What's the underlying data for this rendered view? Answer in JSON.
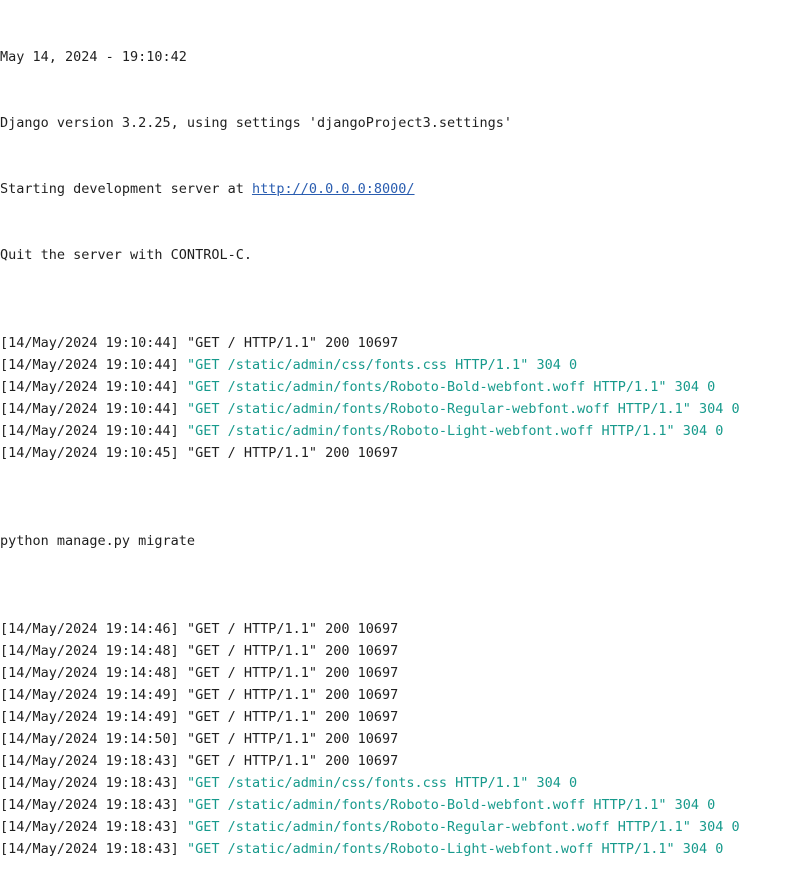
{
  "console": {
    "header": {
      "date_line": "May 14, 2024 - 19:10:42",
      "version_line": "Django version 3.2.25, using settings 'djangoProject3.settings'",
      "server_prefix": "Starting development server at ",
      "server_url": "http://0.0.0.0:8000/",
      "quit_line": "Quit the server with CONTROL-C."
    },
    "log_block_1": [
      {
        "ts": "[14/May/2024 19:10:44]",
        "req": "\"GET / HTTP/1.1\" 200 10697",
        "style": "plain"
      },
      {
        "ts": "[14/May/2024 19:10:44]",
        "req": "\"GET /static/admin/css/fonts.css HTTP/1.1\" 304 0",
        "style": "teal"
      },
      {
        "ts": "[14/May/2024 19:10:44]",
        "req": "\"GET /static/admin/fonts/Roboto-Bold-webfont.woff HTTP/1.1\" 304 0",
        "style": "teal"
      },
      {
        "ts": "[14/May/2024 19:10:44]",
        "req": "\"GET /static/admin/fonts/Roboto-Regular-webfont.woff HTTP/1.1\" 304 0",
        "style": "teal"
      },
      {
        "ts": "[14/May/2024 19:10:44]",
        "req": "\"GET /static/admin/fonts/Roboto-Light-webfont.woff HTTP/1.1\" 304 0",
        "style": "teal"
      },
      {
        "ts": "[14/May/2024 19:10:45]",
        "req": "\"GET / HTTP/1.1\" 200 10697",
        "style": "plain"
      }
    ],
    "command_line": "python manage.py migrate",
    "log_block_2": [
      {
        "ts": "[14/May/2024 19:14:46]",
        "req": "\"GET / HTTP/1.1\" 200 10697",
        "style": "plain"
      },
      {
        "ts": "[14/May/2024 19:14:48]",
        "req": "\"GET / HTTP/1.1\" 200 10697",
        "style": "plain"
      },
      {
        "ts": "[14/May/2024 19:14:48]",
        "req": "\"GET / HTTP/1.1\" 200 10697",
        "style": "plain"
      },
      {
        "ts": "[14/May/2024 19:14:49]",
        "req": "\"GET / HTTP/1.1\" 200 10697",
        "style": "plain"
      },
      {
        "ts": "[14/May/2024 19:14:49]",
        "req": "\"GET / HTTP/1.1\" 200 10697",
        "style": "plain"
      },
      {
        "ts": "[14/May/2024 19:14:50]",
        "req": "\"GET / HTTP/1.1\" 200 10697",
        "style": "plain"
      },
      {
        "ts": "[14/May/2024 19:18:43]",
        "req": "\"GET / HTTP/1.1\" 200 10697",
        "style": "plain"
      },
      {
        "ts": "[14/May/2024 19:18:43]",
        "req": "\"GET /static/admin/css/fonts.css HTTP/1.1\" 304 0",
        "style": "teal"
      },
      {
        "ts": "[14/May/2024 19:18:43]",
        "req": "\"GET /static/admin/fonts/Roboto-Bold-webfont.woff HTTP/1.1\" 304 0",
        "style": "teal"
      },
      {
        "ts": "[14/May/2024 19:18:43]",
        "req": "\"GET /static/admin/fonts/Roboto-Regular-webfont.woff HTTP/1.1\" 304 0",
        "style": "teal"
      },
      {
        "ts": "[14/May/2024 19:18:43]",
        "req": "\"GET /static/admin/fonts/Roboto-Light-webfont.woff HTTP/1.1\" 304 0",
        "style": "teal"
      }
    ]
  },
  "colors": {
    "text": "#1f1f1f",
    "teal_request": "#179a8c",
    "link": "#2a5db0",
    "background": "#ffffff"
  }
}
